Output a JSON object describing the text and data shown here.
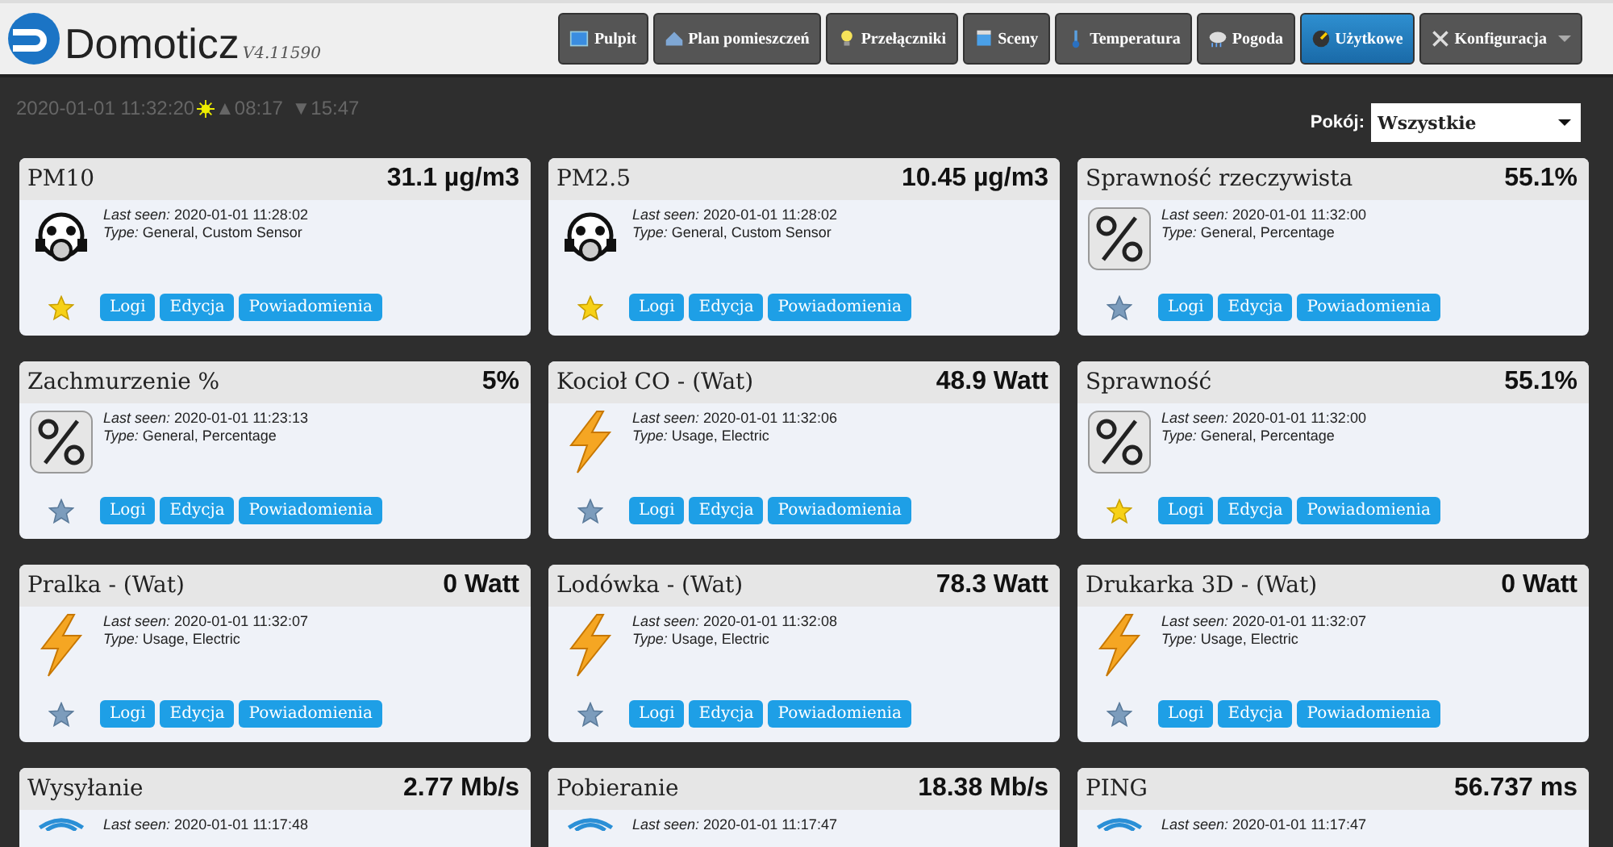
{
  "header": {
    "logo": "Domoticz",
    "version": "V4.11590",
    "nav": [
      {
        "label": "Pulpit",
        "kind": "dashboard",
        "selected": false,
        "dropdown": false
      },
      {
        "label": "Plan pomieszczeń",
        "kind": "house",
        "selected": false,
        "dropdown": false
      },
      {
        "label": "Przełączniki",
        "kind": "bulb",
        "selected": false,
        "dropdown": false
      },
      {
        "label": "Sceny",
        "kind": "scene",
        "selected": false,
        "dropdown": false
      },
      {
        "label": "Temperatura",
        "kind": "thermometer",
        "selected": false,
        "dropdown": false
      },
      {
        "label": "Pogoda",
        "kind": "cloud",
        "selected": false,
        "dropdown": false
      },
      {
        "label": "Użytkowe",
        "kind": "gauge",
        "selected": true,
        "dropdown": false
      },
      {
        "label": "Konfiguracja",
        "kind": "tools",
        "selected": false,
        "dropdown": true
      }
    ]
  },
  "status": {
    "datetime": "2020-01-01 11:32:20",
    "sunrise": "▲08:17",
    "sunset": "▼15:47"
  },
  "room_filter": {
    "label": "Pokój:",
    "value": "Wszystkie"
  },
  "devices": [
    {
      "name": "PM10",
      "value": "31.1 µg/m3",
      "kind": "mask",
      "last_seen_label": "Last seen:",
      "last_seen": "2020-01-01 11:28:02",
      "type_label": "Type:",
      "type": "General, Custom Sensor",
      "favorite": true,
      "buttons": [
        "Logi",
        "Edycja",
        "Powiadomienia"
      ]
    },
    {
      "name": "PM2.5",
      "value": "10.45 µg/m3",
      "kind": "mask",
      "last_seen_label": "Last seen:",
      "last_seen": "2020-01-01 11:28:02",
      "type_label": "Type:",
      "type": "General, Custom Sensor",
      "favorite": true,
      "buttons": [
        "Logi",
        "Edycja",
        "Powiadomienia"
      ]
    },
    {
      "name": "Sprawność rzeczywista",
      "value": "55.1%",
      "kind": "percent",
      "last_seen_label": "Last seen:",
      "last_seen": "2020-01-01 11:32:00",
      "type_label": "Type:",
      "type": "General, Percentage",
      "favorite": false,
      "buttons": [
        "Logi",
        "Edycja",
        "Powiadomienia"
      ]
    },
    {
      "name": "Zachmurzenie %",
      "value": "5%",
      "kind": "percent",
      "last_seen_label": "Last seen:",
      "last_seen": "2020-01-01 11:23:13",
      "type_label": "Type:",
      "type": "General, Percentage",
      "favorite": false,
      "buttons": [
        "Logi",
        "Edycja",
        "Powiadomienia"
      ]
    },
    {
      "name": "Kocioł CO - (Wat)",
      "value": "48.9 Watt",
      "kind": "bolt",
      "last_seen_label": "Last seen:",
      "last_seen": "2020-01-01 11:32:06",
      "type_label": "Type:",
      "type": "Usage, Electric",
      "favorite": false,
      "buttons": [
        "Logi",
        "Edycja",
        "Powiadomienia"
      ]
    },
    {
      "name": "Sprawność",
      "value": "55.1%",
      "kind": "percent",
      "last_seen_label": "Last seen:",
      "last_seen": "2020-01-01 11:32:00",
      "type_label": "Type:",
      "type": "General, Percentage",
      "favorite": true,
      "buttons": [
        "Logi",
        "Edycja",
        "Powiadomienia"
      ]
    },
    {
      "name": "Pralka - (Wat)",
      "value": "0 Watt",
      "kind": "bolt",
      "last_seen_label": "Last seen:",
      "last_seen": "2020-01-01 11:32:07",
      "type_label": "Type:",
      "type": "Usage, Electric",
      "favorite": false,
      "buttons": [
        "Logi",
        "Edycja",
        "Powiadomienia"
      ]
    },
    {
      "name": "Lodówka - (Wat)",
      "value": "78.3 Watt",
      "kind": "bolt",
      "last_seen_label": "Last seen:",
      "last_seen": "2020-01-01 11:32:08",
      "type_label": "Type:",
      "type": "Usage, Electric",
      "favorite": false,
      "buttons": [
        "Logi",
        "Edycja",
        "Powiadomienia"
      ]
    },
    {
      "name": "Drukarka 3D - (Wat)",
      "value": "0 Watt",
      "kind": "bolt",
      "last_seen_label": "Last seen:",
      "last_seen": "2020-01-01 11:32:07",
      "type_label": "Type:",
      "type": "Usage, Electric",
      "favorite": false,
      "buttons": [
        "Logi",
        "Edycja",
        "Powiadomienia"
      ]
    },
    {
      "name": "Wysyłanie",
      "value": "2.77 Mb/s",
      "kind": "wifi",
      "last_seen_label": "Last seen:",
      "last_seen": "2020-01-01 11:17:48"
    },
    {
      "name": "Pobieranie",
      "value": "18.38 Mb/s",
      "kind": "wifi",
      "last_seen_label": "Last seen:",
      "last_seen": "2020-01-01 11:17:47"
    },
    {
      "name": "PING",
      "value": "56.737 ms",
      "kind": "wifi",
      "last_seen_label": "Last seen:",
      "last_seen": "2020-01-01 11:17:47"
    }
  ]
}
